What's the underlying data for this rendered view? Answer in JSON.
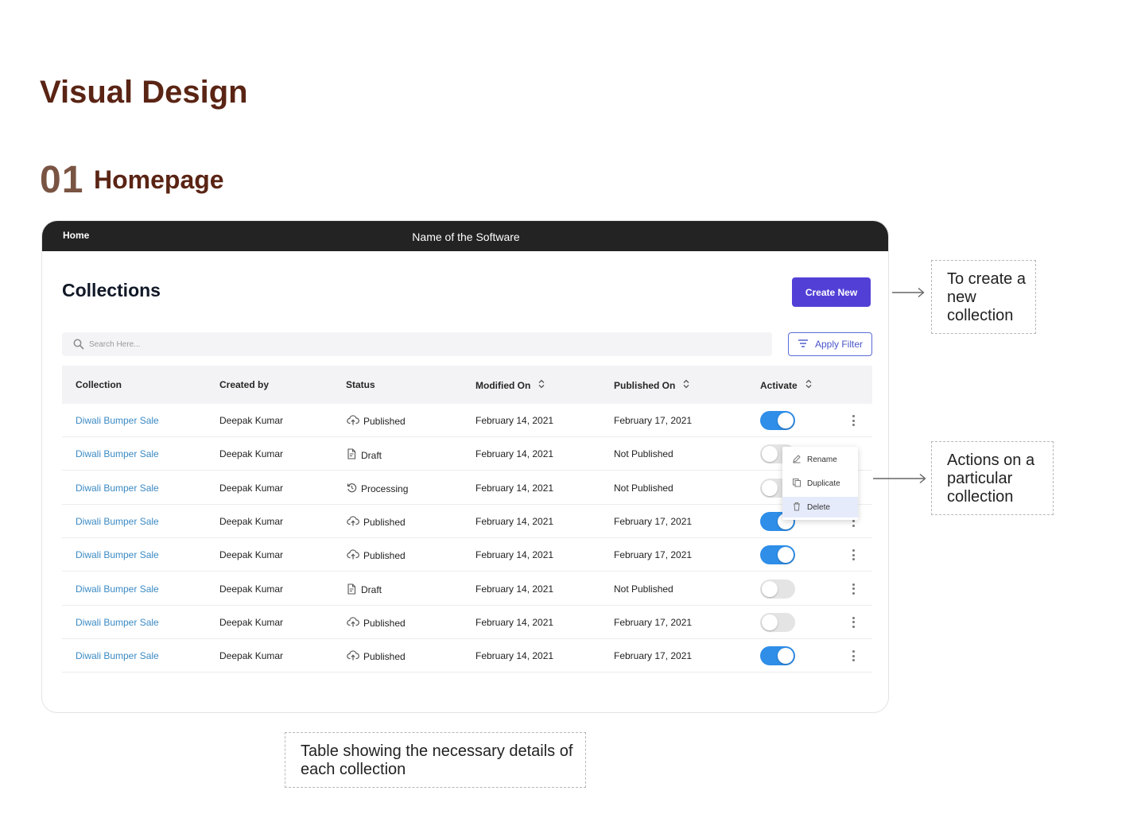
{
  "doc": {
    "title": "Visual Design",
    "section_number": "01",
    "section_title": "Homepage"
  },
  "app": {
    "nav_home": "Home",
    "software_name": "Name of the Software",
    "page_heading": "Collections",
    "create_button": "Create New",
    "search_placeholder": "Search Here...",
    "filter_button": "Apply Filter"
  },
  "table": {
    "headers": [
      "Collection",
      "Created by",
      "Status",
      "Modified On",
      "Published On",
      "Activate"
    ],
    "rows": [
      {
        "collection": "Diwali Bumper Sale",
        "created_by": "Deepak Kumar",
        "status": "Published",
        "status_icon": "cloud-upload-icon",
        "modified": "February 14, 2021",
        "published": "February 17, 2021",
        "active": true
      },
      {
        "collection": "Diwali Bumper Sale",
        "created_by": "Deepak Kumar",
        "status": "Draft",
        "status_icon": "draft-doc-icon",
        "modified": "February 14, 2021",
        "published": "Not Published",
        "active": false
      },
      {
        "collection": "Diwali Bumper Sale",
        "created_by": "Deepak Kumar",
        "status": "Processing",
        "status_icon": "processing-icon",
        "modified": "February 14, 2021",
        "published": "Not Published",
        "active": false
      },
      {
        "collection": "Diwali Bumper Sale",
        "created_by": "Deepak Kumar",
        "status": "Published",
        "status_icon": "cloud-upload-icon",
        "modified": "February 14, 2021",
        "published": "February 17, 2021",
        "active": true
      },
      {
        "collection": "Diwali Bumper Sale",
        "created_by": "Deepak Kumar",
        "status": "Published",
        "status_icon": "cloud-upload-icon",
        "modified": "February 14, 2021",
        "published": "February 17, 2021",
        "active": true
      },
      {
        "collection": "Diwali Bumper Sale",
        "created_by": "Deepak Kumar",
        "status": "Draft",
        "status_icon": "draft-doc-icon",
        "modified": "February 14, 2021",
        "published": "Not Published",
        "active": false
      },
      {
        "collection": "Diwali Bumper Sale",
        "created_by": "Deepak Kumar",
        "status": "Published",
        "status_icon": "cloud-upload-icon",
        "modified": "February 14, 2021",
        "published": "February 17, 2021",
        "active": false
      },
      {
        "collection": "Diwali Bumper Sale",
        "created_by": "Deepak Kumar",
        "status": "Published",
        "status_icon": "cloud-upload-icon",
        "modified": "February 14, 2021",
        "published": "February 17, 2021",
        "active": true
      }
    ]
  },
  "context_menu": {
    "items": [
      {
        "label": "Rename",
        "icon": "pencil-icon"
      },
      {
        "label": "Duplicate",
        "icon": "copy-icon"
      },
      {
        "label": "Delete",
        "icon": "trash-icon"
      }
    ],
    "highlighted": "Delete"
  },
  "annotations": {
    "create_new": "To create a new collection",
    "actions": "Actions on a particular collection",
    "table": "Table showing the necessary details of each collection"
  },
  "colors": {
    "heading_brown": "#5a2414",
    "primary_button": "#5240d6",
    "toggle_on": "#2e8ee8",
    "link_blue": "#3b8ac4",
    "topbar": "#232323"
  }
}
